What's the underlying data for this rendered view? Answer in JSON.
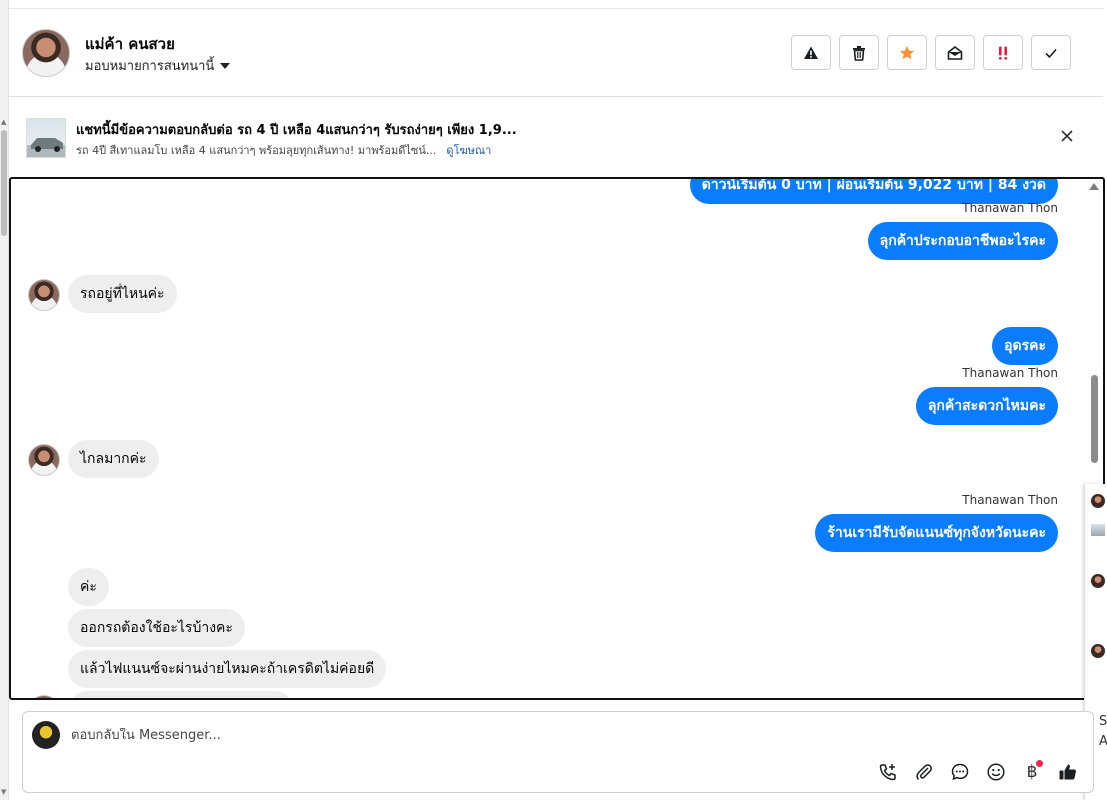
{
  "header": {
    "name": "แม่ค้า คนสวย",
    "assign_label": "มอบหมายการสนทนานี้",
    "actions": [
      {
        "icon": "warning-icon"
      },
      {
        "icon": "trash-icon"
      },
      {
        "icon": "star-icon",
        "color": "#f7923a"
      },
      {
        "icon": "mark-unread-icon"
      },
      {
        "icon": "spam-icon",
        "color": "#e41e3f"
      },
      {
        "icon": "check-icon"
      }
    ]
  },
  "ad": {
    "title": "แชทนี้มีข้อความตอบกลับต่อ รถ 4 ปี เหลือ 4แสนกว่าๆ รับรถง่ายๆ เพียง 1,9...",
    "subtitle": "รถ 4ปี สีเทาแลมโบ เหลือ 4 แสนกว่าๆ พร้อมลุยทุกเส้นทาง! มาพร้อมดีไซน์...",
    "link": "ดูโฆษณา"
  },
  "messages": {
    "top_partial": "ดาวน์เริ่มต้น 0 บาท | ผ่อนเริ่มต้น 9,022 บาท | 84 งวด",
    "sender1": "Thanawan Thon",
    "out1": "ลุกค้าประกอบอาชีพอะไรคะ",
    "in1": "รถอยู่ที่ไหนค่ะ",
    "out2": "อุดรคะ",
    "sender2": "Thanawan Thon",
    "out3": "ลุกค้าสะดวกไหมคะ",
    "in2": "ไกลมากค่ะ",
    "sender3": "Thanawan Thon",
    "out4": "ร้านเรามีรับจัดแนนซ์ทุกจังหวัดนะคะ",
    "in3": "ค่ะ",
    "in4": "ออกรถต้องใช้อะไรบ้างคะ",
    "in5": "แล้วไฟแนนซ์จะผ่านง่ายไหมคะถ้าเครดิตไม่ค่อยดี"
  },
  "side_popup": {
    "text1": "S",
    "text2": "A"
  },
  "composer": {
    "placeholder": "ตอบกลับใน Messenger...",
    "tools": [
      "add-call-icon",
      "attachment-icon",
      "saved-reply-icon",
      "emoji-icon",
      "payment-icon",
      "like-icon"
    ],
    "payment_symbol": "฿"
  },
  "colors": {
    "accent": "#0a7cff",
    "incoming_bubble": "#eeeeee",
    "notification_dot": "#f02849"
  }
}
